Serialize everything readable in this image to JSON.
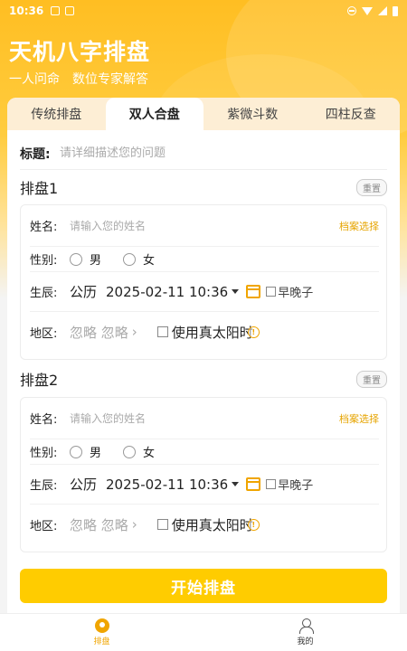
{
  "status": {
    "time": "10:36"
  },
  "app": {
    "title": "天机八字排盘",
    "subtitle_left": "一人问命",
    "subtitle_right": "数位专家解答"
  },
  "tabs": [
    {
      "label": "传统排盘",
      "active": false
    },
    {
      "label": "双人合盘",
      "active": true
    },
    {
      "label": "紫微斗数",
      "active": false
    },
    {
      "label": "四柱反查",
      "active": false
    }
  ],
  "title_row": {
    "label": "标题:",
    "placeholder": "请详细描述您的问题"
  },
  "charts": [
    {
      "title": "排盘1",
      "reset": "重置",
      "name_label": "姓名:",
      "name_placeholder": "请输入您的姓名",
      "archive": "档案选择",
      "gender_label": "性别:",
      "male": "男",
      "female": "女",
      "birth_label": "生辰:",
      "calendar": "公历",
      "datetime": "2025-02-11 10:36",
      "early": "早晚子",
      "region_label": "地区:",
      "region_value": "忽略 忽略",
      "solar": "使用真太阳时"
    },
    {
      "title": "排盘2",
      "reset": "重置",
      "name_label": "姓名:",
      "name_placeholder": "请输入您的姓名",
      "archive": "档案选择",
      "gender_label": "性别:",
      "male": "男",
      "female": "女",
      "birth_label": "生辰:",
      "calendar": "公历",
      "datetime": "2025-02-11 10:36",
      "early": "早晚子",
      "region_label": "地区:",
      "region_value": "忽略 忽略",
      "solar": "使用真太阳时"
    }
  ],
  "start_button": "开始排盘",
  "nav": [
    {
      "label": "排盘",
      "active": true
    },
    {
      "label": "我的",
      "active": false
    }
  ],
  "colors": {
    "accent": "#ffcc00",
    "brand_orange": "#f0a500",
    "header_start": "#ffbe22"
  }
}
